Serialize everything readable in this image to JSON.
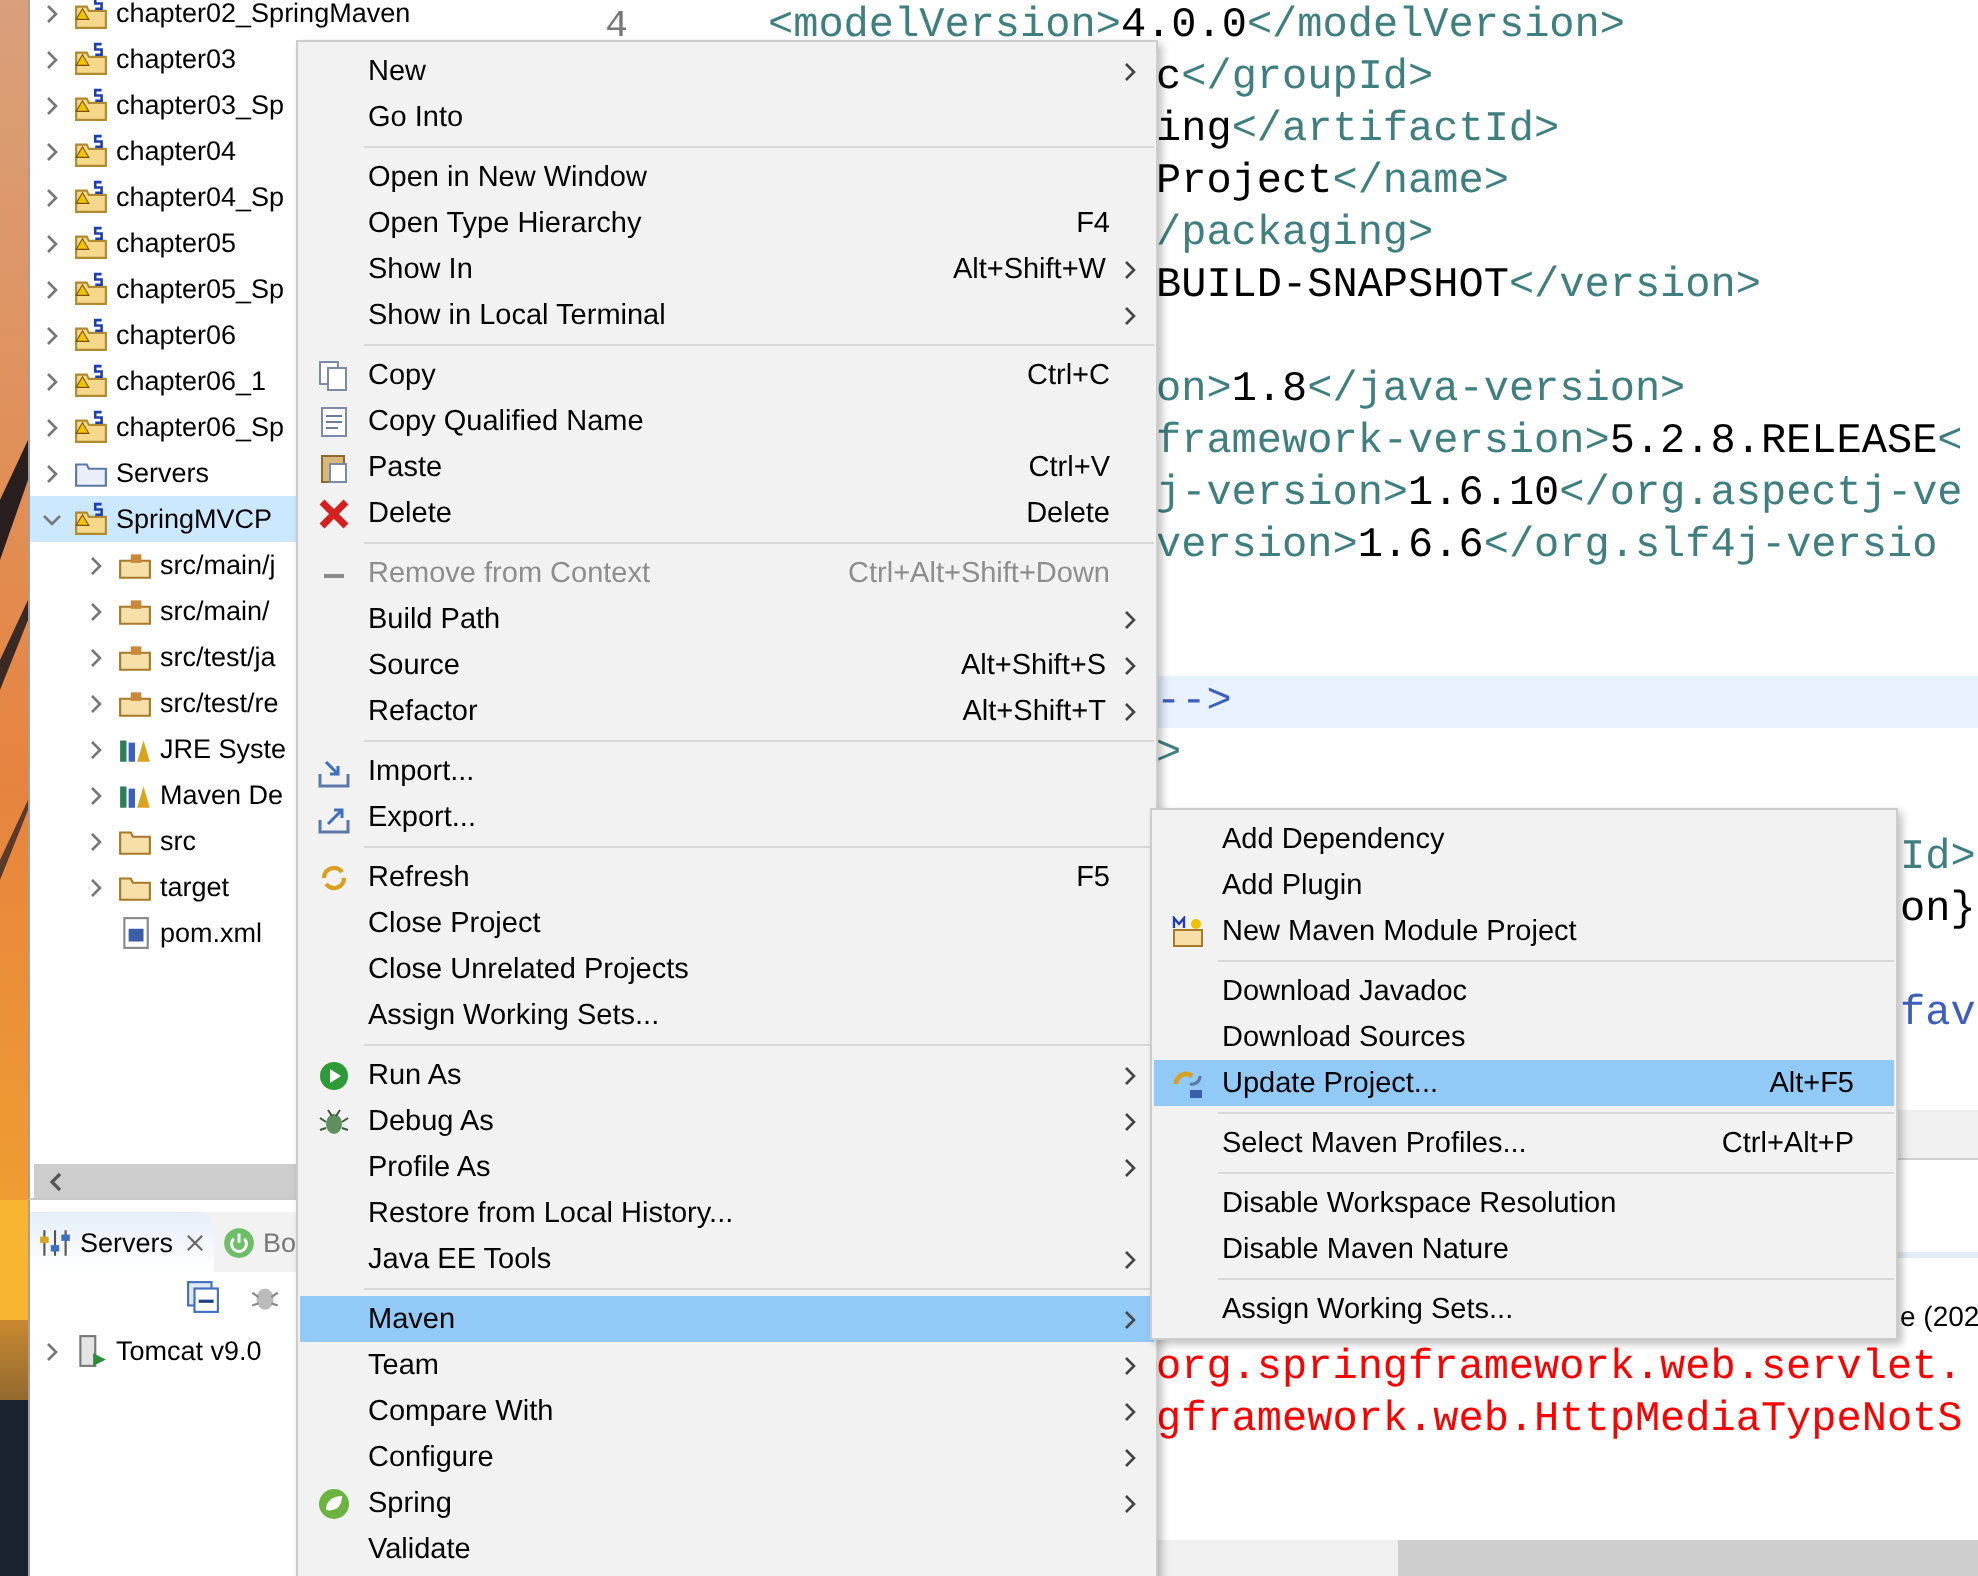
{
  "explorer": {
    "items": [
      {
        "label": "chapter02_SpringMaven",
        "kind": "project",
        "expanded": false,
        "selected": false
      },
      {
        "label": "chapter03",
        "kind": "project",
        "expanded": false,
        "selected": false
      },
      {
        "label": "chapter03_Sp",
        "kind": "project",
        "expanded": false,
        "selected": false
      },
      {
        "label": "chapter04",
        "kind": "project",
        "expanded": false,
        "selected": false
      },
      {
        "label": "chapter04_Sp",
        "kind": "project",
        "expanded": false,
        "selected": false
      },
      {
        "label": "chapter05",
        "kind": "project",
        "expanded": false,
        "selected": false
      },
      {
        "label": "chapter05_Sp",
        "kind": "project",
        "expanded": false,
        "selected": false
      },
      {
        "label": "chapter06",
        "kind": "project",
        "expanded": false,
        "selected": false
      },
      {
        "label": "chapter06_1",
        "kind": "project",
        "expanded": false,
        "selected": false
      },
      {
        "label": "chapter06_Sp",
        "kind": "project",
        "expanded": false,
        "selected": false
      },
      {
        "label": "Servers",
        "kind": "folder",
        "expanded": false,
        "selected": false
      },
      {
        "label": "SpringMVCP",
        "kind": "project",
        "expanded": true,
        "selected": true,
        "children": [
          {
            "label": "src/main/j",
            "kind": "source-folder",
            "expanded": false,
            "selected": false
          },
          {
            "label": "src/main/",
            "kind": "source-folder",
            "expanded": false,
            "selected": false
          },
          {
            "label": "src/test/ja",
            "kind": "source-folder",
            "expanded": false,
            "selected": false
          },
          {
            "label": "src/test/re",
            "kind": "source-folder",
            "expanded": false,
            "selected": false
          },
          {
            "label": "JRE Syste",
            "kind": "library",
            "expanded": false,
            "selected": false
          },
          {
            "label": "Maven De",
            "kind": "library",
            "expanded": false,
            "selected": false
          },
          {
            "label": "src",
            "kind": "folder",
            "expanded": false,
            "selected": false
          },
          {
            "label": "target",
            "kind": "folder",
            "expanded": false,
            "selected": false
          },
          {
            "label": "pom.xml",
            "kind": "file",
            "selected": false
          }
        ]
      }
    ]
  },
  "servers_panel": {
    "tabs": [
      {
        "label": "Servers",
        "selected": true
      },
      {
        "label": "Bo",
        "selected": false
      }
    ],
    "items": [
      {
        "label": "Tomcat v9.0",
        "expanded": false
      }
    ]
  },
  "editor": {
    "lines": [
      {
        "kind": "cut-top",
        "number": "4",
        "segments": [
          {
            "kind": "tag",
            "text": "<modelVersion>"
          },
          {
            "kind": "text",
            "text": "4.0.0"
          },
          {
            "kind": "tag",
            "text": "</modelVersion>"
          }
        ]
      },
      {
        "kind": "visible",
        "segments": [
          {
            "kind": "text",
            "text": "c"
          },
          {
            "kind": "tag",
            "text": "</groupId>"
          }
        ]
      },
      {
        "kind": "visible",
        "segments": [
          {
            "kind": "text",
            "text": "ing"
          },
          {
            "kind": "tag",
            "text": "</artifactId>"
          }
        ]
      },
      {
        "kind": "visible",
        "segments": [
          {
            "kind": "text",
            "text": "Project"
          },
          {
            "kind": "tag",
            "text": "</name>"
          }
        ]
      },
      {
        "kind": "visible",
        "segments": [
          {
            "kind": "tag",
            "text": "/packaging>"
          }
        ]
      },
      {
        "kind": "visible",
        "segments": [
          {
            "kind": "text",
            "text": "BUILD-SNAPSHOT"
          },
          {
            "kind": "tag",
            "text": "</version>"
          }
        ]
      },
      {
        "kind": "visible"
      },
      {
        "kind": "visible",
        "segments": [
          {
            "kind": "tag",
            "text": "on>"
          },
          {
            "kind": "text",
            "text": "1.8"
          },
          {
            "kind": "tag",
            "text": "</java-version>"
          }
        ]
      },
      {
        "kind": "visible",
        "segments": [
          {
            "kind": "tag",
            "text": "framework-version>"
          },
          {
            "kind": "text",
            "text": "5.2.8.RELEASE"
          },
          {
            "kind": "tag",
            "text": "<"
          }
        ]
      },
      {
        "kind": "visible",
        "segments": [
          {
            "kind": "tag",
            "text": "j-version>"
          },
          {
            "kind": "text",
            "text": "1.6.10"
          },
          {
            "kind": "tag",
            "text": "</org.aspectj-ve"
          }
        ]
      },
      {
        "kind": "visible",
        "segments": [
          {
            "kind": "tag",
            "text": "version>"
          },
          {
            "kind": "text",
            "text": "1.6.6"
          },
          {
            "kind": "tag",
            "text": "</org.slf4j-versio"
          }
        ]
      },
      {
        "kind": "visible"
      },
      {
        "kind": "visible"
      },
      {
        "kind": "current",
        "segments": [
          {
            "kind": "comment",
            "text": " -->"
          }
        ]
      },
      {
        "kind": "visible",
        "segments": [
          {
            "kind": "tag",
            "text": ">"
          }
        ]
      },
      {
        "kind": "visible"
      },
      {
        "kind": "behind-submenu",
        "segments": [
          {
            "kind": "tag",
            "text": "Id>"
          }
        ]
      },
      {
        "kind": "behind-submenu",
        "segments": [
          {
            "kind": "text",
            "text": "on}"
          }
        ]
      },
      {
        "kind": "behind-submenu"
      },
      {
        "kind": "behind-submenu",
        "segments": [
          {
            "kind": "comment",
            "text": "fav"
          }
        ]
      }
    ]
  },
  "console": {
    "lines": [
      {
        "kind": "behind-submenu",
        "text": "e (202"
      },
      {
        "kind": "error",
        "text": "org.springframework.web.servlet."
      },
      {
        "kind": "error",
        "text": "gframework.web.HttpMediaTypeNotS"
      }
    ]
  },
  "context_menu": {
    "items": [
      {
        "kind": "item",
        "label": "New",
        "has_submenu": true,
        "disabled": false,
        "selected": false
      },
      {
        "kind": "item",
        "label": "Go Into",
        "has_submenu": false,
        "disabled": false,
        "selected": false
      },
      {
        "kind": "separator"
      },
      {
        "kind": "item",
        "label": "Open in New Window",
        "has_submenu": false,
        "disabled": false,
        "selected": false
      },
      {
        "kind": "item",
        "label": "Open Type Hierarchy",
        "shortcut": "F4",
        "has_submenu": false,
        "disabled": false,
        "selected": false
      },
      {
        "kind": "item",
        "label": "Show In",
        "shortcut": "Alt+Shift+W",
        "has_submenu": true,
        "disabled": false,
        "selected": false
      },
      {
        "kind": "item",
        "label": "Show in Local Terminal",
        "has_submenu": true,
        "disabled": false,
        "selected": false
      },
      {
        "kind": "separator"
      },
      {
        "kind": "item",
        "label": "Copy",
        "shortcut": "Ctrl+C",
        "has_submenu": false,
        "disabled": false,
        "selected": false
      },
      {
        "kind": "item",
        "label": "Copy Qualified Name",
        "has_submenu": false,
        "disabled": false,
        "selected": false
      },
      {
        "kind": "item",
        "label": "Paste",
        "shortcut": "Ctrl+V",
        "has_submenu": false,
        "disabled": false,
        "selected": false
      },
      {
        "kind": "item",
        "label": "Delete",
        "shortcut": "Delete",
        "has_submenu": false,
        "disabled": false,
        "selected": false
      },
      {
        "kind": "separator"
      },
      {
        "kind": "item",
        "label": "Remove from Context",
        "shortcut": "Ctrl+Alt+Shift+Down",
        "has_submenu": false,
        "disabled": true,
        "selected": false
      },
      {
        "kind": "item",
        "label": "Build Path",
        "has_submenu": true,
        "disabled": false,
        "selected": false
      },
      {
        "kind": "item",
        "label": "Source",
        "shortcut": "Alt+Shift+S",
        "has_submenu": true,
        "disabled": false,
        "selected": false
      },
      {
        "kind": "item",
        "label": "Refactor",
        "shortcut": "Alt+Shift+T",
        "has_submenu": true,
        "disabled": false,
        "selected": false
      },
      {
        "kind": "separator"
      },
      {
        "kind": "item",
        "label": "Import...",
        "has_submenu": false,
        "disabled": false,
        "selected": false
      },
      {
        "kind": "item",
        "label": "Export...",
        "has_submenu": false,
        "disabled": false,
        "selected": false
      },
      {
        "kind": "separator"
      },
      {
        "kind": "item",
        "label": "Refresh",
        "shortcut": "F5",
        "has_submenu": false,
        "disabled": false,
        "selected": false
      },
      {
        "kind": "item",
        "label": "Close Project",
        "has_submenu": false,
        "disabled": false,
        "selected": false
      },
      {
        "kind": "item",
        "label": "Close Unrelated Projects",
        "has_submenu": false,
        "disabled": false,
        "selected": false
      },
      {
        "kind": "item",
        "label": "Assign Working Sets...",
        "has_submenu": false,
        "disabled": false,
        "selected": false
      },
      {
        "kind": "separator"
      },
      {
        "kind": "item",
        "label": "Run As",
        "has_submenu": true,
        "disabled": false,
        "selected": false
      },
      {
        "kind": "item",
        "label": "Debug As",
        "has_submenu": true,
        "disabled": false,
        "selected": false
      },
      {
        "kind": "item",
        "label": "Profile As",
        "has_submenu": true,
        "disabled": false,
        "selected": false
      },
      {
        "kind": "item",
        "label": "Restore from Local History...",
        "has_submenu": false,
        "disabled": false,
        "selected": false
      },
      {
        "kind": "item",
        "label": "Java EE Tools",
        "has_submenu": true,
        "disabled": false,
        "selected": false
      },
      {
        "kind": "separator"
      },
      {
        "kind": "item",
        "label": "Maven",
        "has_submenu": true,
        "disabled": false,
        "selected": true
      },
      {
        "kind": "item",
        "label": "Team",
        "has_submenu": true,
        "disabled": false,
        "selected": false
      },
      {
        "kind": "item",
        "label": "Compare With",
        "has_submenu": true,
        "disabled": false,
        "selected": false
      },
      {
        "kind": "item",
        "label": "Configure",
        "has_submenu": true,
        "disabled": false,
        "selected": false
      },
      {
        "kind": "item",
        "label": "Spring",
        "has_submenu": true,
        "disabled": false,
        "selected": false
      },
      {
        "kind": "item",
        "label": "Validate",
        "has_submenu": false,
        "disabled": false,
        "selected": false
      }
    ]
  },
  "maven_submenu": {
    "items": [
      {
        "kind": "item",
        "label": "Add Dependency",
        "selected": false
      },
      {
        "kind": "item",
        "label": "Add Plugin",
        "selected": false
      },
      {
        "kind": "item",
        "label": "New Maven Module Project",
        "selected": false
      },
      {
        "kind": "separator"
      },
      {
        "kind": "item",
        "label": "Download Javadoc",
        "selected": false
      },
      {
        "kind": "item",
        "label": "Download Sources",
        "selected": false
      },
      {
        "kind": "item",
        "label": "Update Project...",
        "shortcut": "Alt+F5",
        "selected": true
      },
      {
        "kind": "separator"
      },
      {
        "kind": "item",
        "label": "Select Maven Profiles...",
        "shortcut": "Ctrl+Alt+P",
        "selected": false
      },
      {
        "kind": "separator"
      },
      {
        "kind": "item",
        "label": "Disable Workspace Resolution",
        "selected": false
      },
      {
        "kind": "item",
        "label": "Disable Maven Nature",
        "selected": false
      },
      {
        "kind": "separator"
      },
      {
        "kind": "item",
        "label": "Assign Working Sets...",
        "selected": false
      }
    ]
  }
}
